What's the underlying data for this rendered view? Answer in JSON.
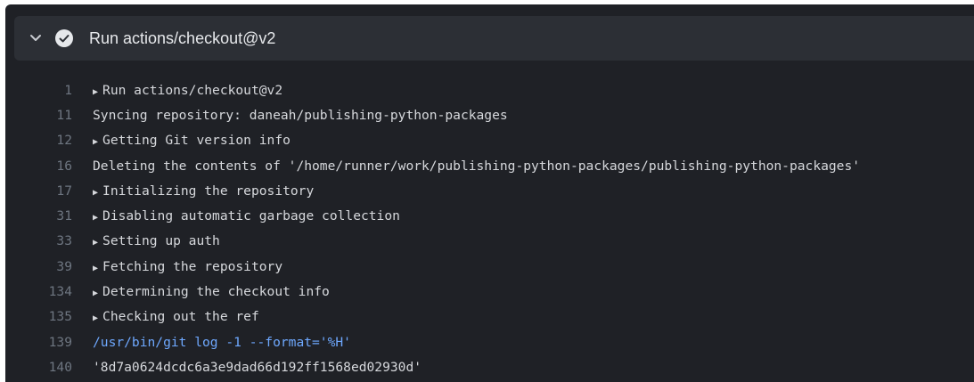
{
  "step": {
    "title": "Run actions/checkout@v2",
    "chevron_icon": "chevron-down-icon",
    "status_icon": "check-circle-icon",
    "status_color": "#e6e8eb"
  },
  "log_lines": [
    {
      "num": "1",
      "text": "Run actions/checkout@v2",
      "group": true
    },
    {
      "num": "11",
      "text": "Syncing repository: daneah/publishing-python-packages",
      "group": false
    },
    {
      "num": "12",
      "text": "Getting Git version info",
      "group": true
    },
    {
      "num": "16",
      "text": "Deleting the contents of '/home/runner/work/publishing-python-packages/publishing-python-packages'",
      "group": false
    },
    {
      "num": "17",
      "text": "Initializing the repository",
      "group": true
    },
    {
      "num": "31",
      "text": "Disabling automatic garbage collection",
      "group": true
    },
    {
      "num": "33",
      "text": "Setting up auth",
      "group": true
    },
    {
      "num": "39",
      "text": "Fetching the repository",
      "group": true
    },
    {
      "num": "134",
      "text": "Determining the checkout info",
      "group": true
    },
    {
      "num": "135",
      "text": "Checking out the ref",
      "group": true
    },
    {
      "num": "139",
      "text": "/usr/bin/git log -1 --format='%H'",
      "group": false,
      "command": true
    },
    {
      "num": "140",
      "text": "'8d7a0624dcdc6a3e9dad66d192ff1568ed02930d'",
      "group": false
    }
  ],
  "colors": {
    "background": "#1f2126",
    "header_background": "#2c2f35",
    "command_text": "#6ea8fe",
    "line_number": "#6e7681"
  }
}
